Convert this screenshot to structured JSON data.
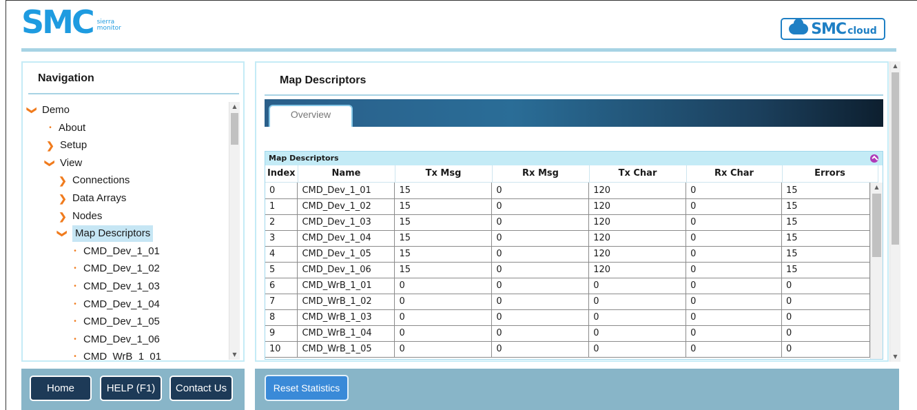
{
  "header": {
    "logo_main": "SMC",
    "logo_sub_line1": "sierra",
    "logo_sub_line2": "monitor",
    "cloud_main": "SMC",
    "cloud_sub": "cloud"
  },
  "nav": {
    "title": "Navigation",
    "items": [
      {
        "label": "Demo",
        "icon": "chevron-down-icon",
        "level": 0,
        "selected": false
      },
      {
        "label": "About",
        "icon": "bullet-icon",
        "level": 1,
        "selected": false
      },
      {
        "label": "Setup",
        "icon": "chevron-right-icon",
        "level": 1,
        "selected": false
      },
      {
        "label": "View",
        "icon": "chevron-down-icon",
        "level": 1,
        "selected": false
      },
      {
        "label": "Connections",
        "icon": "chevron-right-icon",
        "level": 2,
        "selected": false
      },
      {
        "label": "Data Arrays",
        "icon": "chevron-right-icon",
        "level": 2,
        "selected": false
      },
      {
        "label": "Nodes",
        "icon": "chevron-right-icon",
        "level": 2,
        "selected": false
      },
      {
        "label": "Map Descriptors",
        "icon": "chevron-down-icon",
        "level": 2,
        "selected": true
      },
      {
        "label": "CMD_Dev_1_01",
        "icon": "bullet-icon",
        "level": 3,
        "selected": false
      },
      {
        "label": "CMD_Dev_1_02",
        "icon": "bullet-icon",
        "level": 3,
        "selected": false
      },
      {
        "label": "CMD_Dev_1_03",
        "icon": "bullet-icon",
        "level": 3,
        "selected": false
      },
      {
        "label": "CMD_Dev_1_04",
        "icon": "bullet-icon",
        "level": 3,
        "selected": false
      },
      {
        "label": "CMD_Dev_1_05",
        "icon": "bullet-icon",
        "level": 3,
        "selected": false
      },
      {
        "label": "CMD_Dev_1_06",
        "icon": "bullet-icon",
        "level": 3,
        "selected": false
      },
      {
        "label": "CMD_WrB_1_01",
        "icon": "bullet-icon",
        "level": 3,
        "selected": false
      }
    ],
    "buttons": {
      "home": "Home",
      "help": "HELP (F1)",
      "contact": "Contact Us"
    }
  },
  "main": {
    "title": "Map Descriptors",
    "tab_overview": "Overview",
    "grid_caption": "Map Descriptors",
    "columns": [
      "Index",
      "Name",
      "Tx Msg",
      "Rx Msg",
      "Tx Char",
      "Rx Char",
      "Errors"
    ],
    "rows": [
      [
        "0",
        "CMD_Dev_1_01",
        "15",
        "0",
        "120",
        "0",
        "15"
      ],
      [
        "1",
        "CMD_Dev_1_02",
        "15",
        "0",
        "120",
        "0",
        "15"
      ],
      [
        "2",
        "CMD_Dev_1_03",
        "15",
        "0",
        "120",
        "0",
        "15"
      ],
      [
        "3",
        "CMD_Dev_1_04",
        "15",
        "0",
        "120",
        "0",
        "15"
      ],
      [
        "4",
        "CMD_Dev_1_05",
        "15",
        "0",
        "120",
        "0",
        "15"
      ],
      [
        "5",
        "CMD_Dev_1_06",
        "15",
        "0",
        "120",
        "0",
        "15"
      ],
      [
        "6",
        "CMD_WrB_1_01",
        "0",
        "0",
        "0",
        "0",
        "0"
      ],
      [
        "7",
        "CMD_WrB_1_02",
        "0",
        "0",
        "0",
        "0",
        "0"
      ],
      [
        "8",
        "CMD_WrB_1_03",
        "0",
        "0",
        "0",
        "0",
        "0"
      ],
      [
        "9",
        "CMD_WrB_1_04",
        "0",
        "0",
        "0",
        "0",
        "0"
      ],
      [
        "10",
        "CMD_WrB_1_05",
        "0",
        "0",
        "0",
        "0",
        "0"
      ]
    ],
    "reset_button": "Reset Statistics"
  },
  "colors": {
    "accent_orange": "#f07b1d",
    "brand_blue": "#1e9be0",
    "panel_border": "#c4ebf6",
    "bottom_bar": "#88b5c8",
    "dark_button": "#1d3a57",
    "reset_button": "#3a8ad8"
  }
}
